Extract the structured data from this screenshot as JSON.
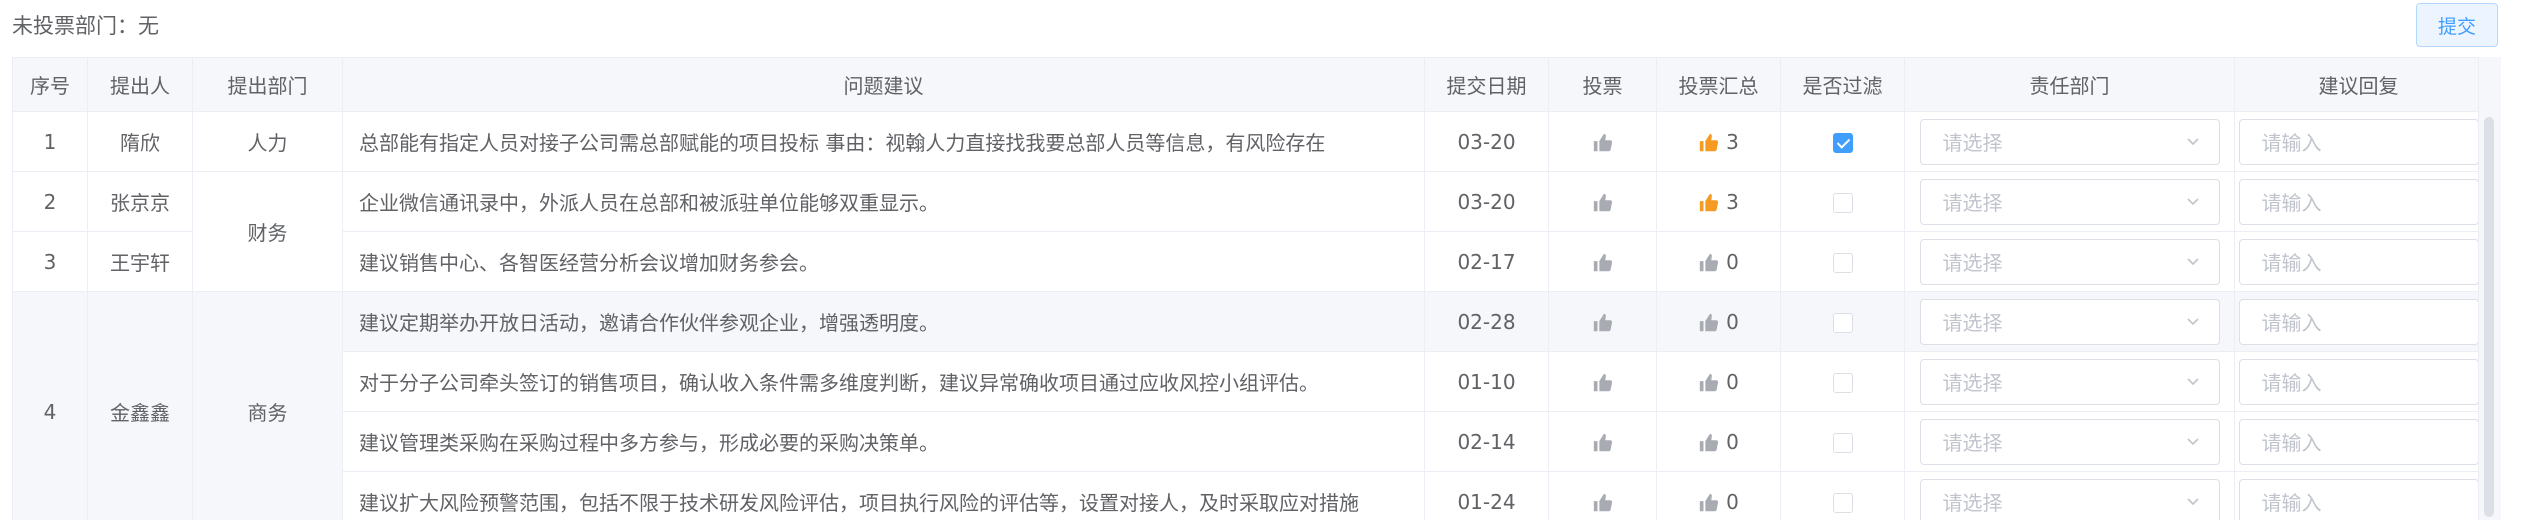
{
  "header": {
    "unvoted": "未投票部门：无",
    "submit_label": "提交"
  },
  "columns": [
    "序号",
    "提出人",
    "提出部门",
    "问题建议",
    "提交日期",
    "投票",
    "投票汇总",
    "是否过滤",
    "责任部门",
    "建议回复"
  ],
  "rows": [
    {
      "no": "1",
      "person": "隋欣",
      "dept": "人力",
      "issue": "总部能有指定人员对接子公司需总部赋能的项目投标 事由：视翰人力直接找我要总部人员等信息，有风险存在",
      "date": "03-20",
      "total": "3",
      "highlight": true,
      "filtered": true
    },
    {
      "no": "2",
      "person": "张京京",
      "dept": "财务",
      "issue": "企业微信通讯录中，外派人员在总部和被派驻单位能够双重显示。",
      "date": "03-20",
      "total": "3",
      "highlight": true,
      "filtered": false
    },
    {
      "no": "3",
      "person": "王宇轩",
      "dept": "",
      "issue": "建议销售中心、各智医经营分析会议增加财务参会。",
      "date": "02-17",
      "total": "0",
      "highlight": false,
      "filtered": false
    },
    {
      "no": "4",
      "person": "金鑫鑫",
      "dept": "商务",
      "issue": "建议定期举办开放日活动，邀请合作伙伴参观企业，增强透明度。",
      "date": "02-28",
      "total": "0",
      "highlight": false,
      "filtered": false
    },
    {
      "no": "",
      "person": "",
      "dept": "",
      "issue": "对于分子公司牵头签订的销售项目，确认收入条件需多维度判断，建议异常确收项目通过应收风控小组评估。",
      "date": "01-10",
      "total": "0",
      "highlight": false,
      "filtered": false
    },
    {
      "no": "",
      "person": "",
      "dept": "",
      "issue": "建议管理类采购在采购过程中多方参与，形成必要的采购决策单。",
      "date": "02-14",
      "total": "0",
      "highlight": false,
      "filtered": false
    },
    {
      "no": "",
      "person": "",
      "dept": "",
      "issue": "建议扩大风险预警范围，包括不限于技术研发风险评估，项目执行风险的评估等，设置对接人，及时采取应对措施",
      "date": "01-24",
      "total": "0",
      "highlight": false,
      "filtered": false
    }
  ],
  "select_placeholder": "请选择",
  "input_placeholder": "请输入",
  "colors": {
    "accent": "#409eff",
    "thumb_active": "#f59a23",
    "thumb_idle": "#a8abb2"
  },
  "icons": [
    "thumbs-up-icon",
    "chevron-down-icon",
    "checkbox-icon"
  ]
}
